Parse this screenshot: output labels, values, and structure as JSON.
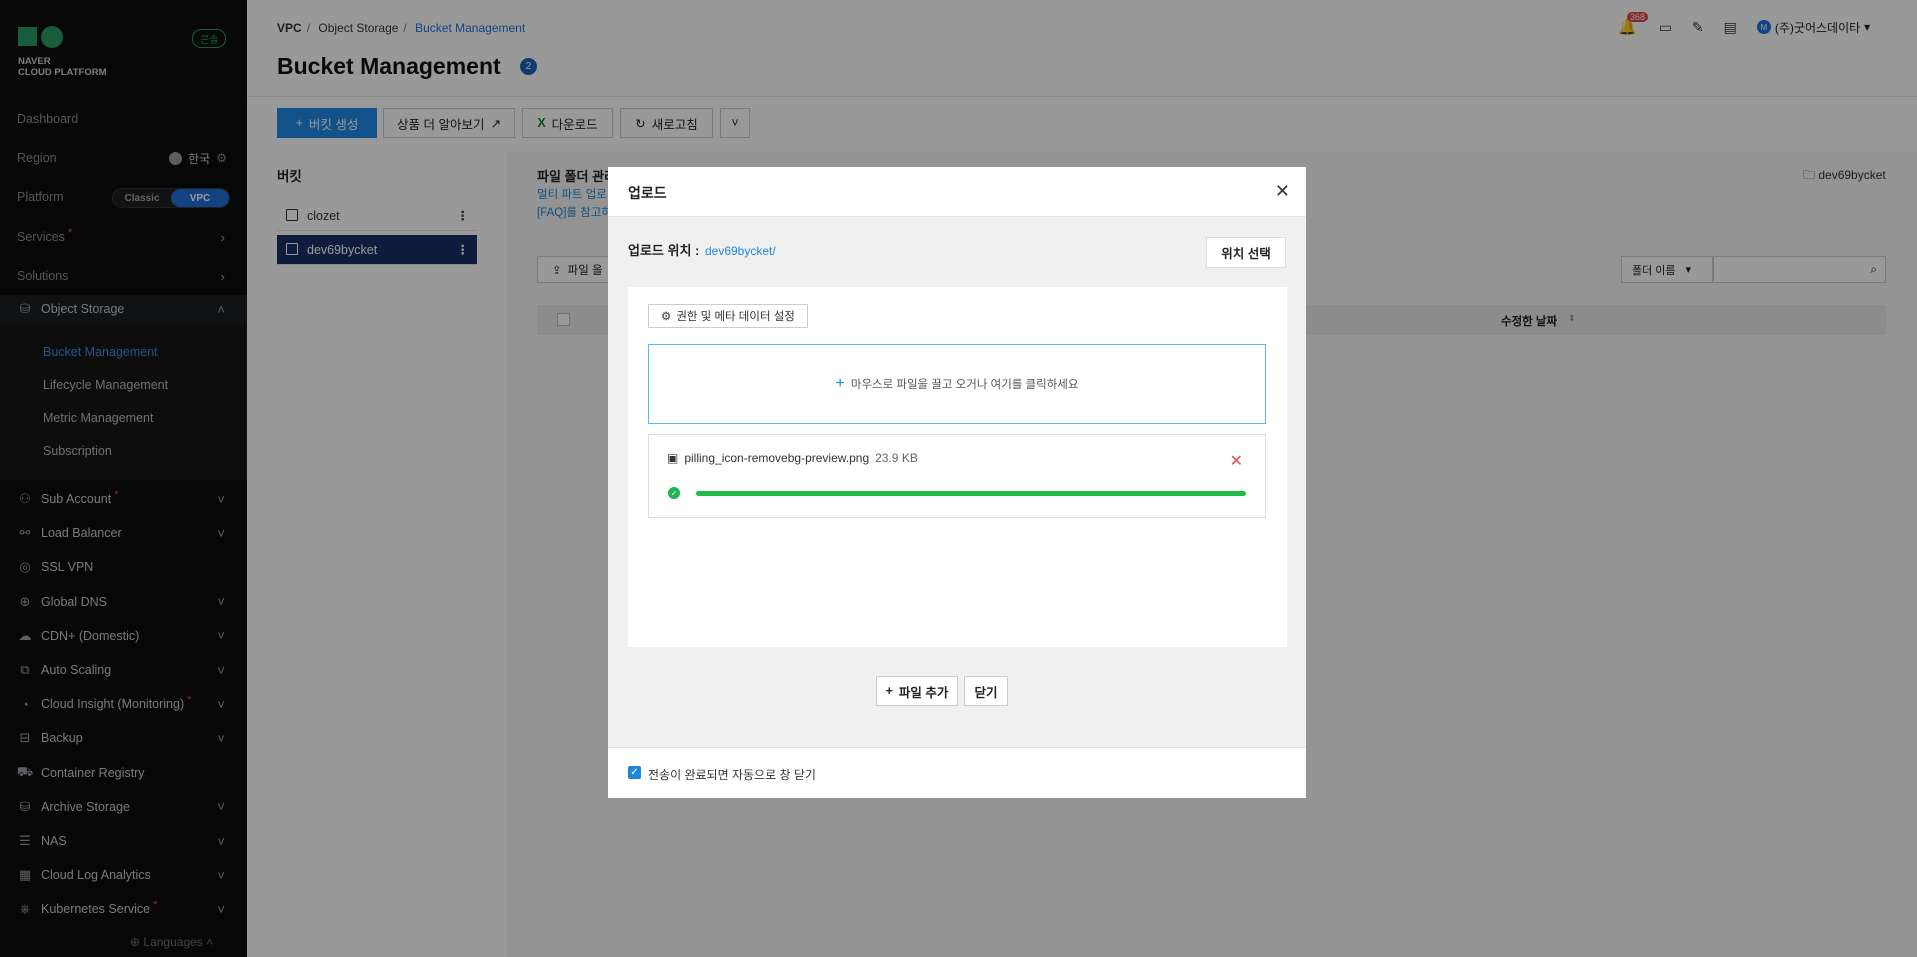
{
  "sidebar": {
    "badge": "콘솔",
    "logo_line1": "NAVER",
    "logo_line2": "CLOUD PLATFORM",
    "dashboard": "Dashboard",
    "region_label": "Region",
    "region_value": "한국",
    "platform_label": "Platform",
    "platform_options": [
      "Classic",
      "VPC"
    ],
    "services": "Services",
    "solutions": "Solutions",
    "object_storage": "Object Storage",
    "os_sub": [
      "Bucket Management",
      "Lifecycle Management",
      "Metric Management",
      "Subscription"
    ],
    "items": [
      {
        "label": "Sub Account",
        "star": true,
        "chevron": true
      },
      {
        "label": "Load Balancer",
        "star": false,
        "chevron": true
      },
      {
        "label": "SSL VPN",
        "star": false,
        "chevron": false
      },
      {
        "label": "Global DNS",
        "star": false,
        "chevron": true
      },
      {
        "label": "CDN+ (Domestic)",
        "star": false,
        "chevron": true
      },
      {
        "label": "Auto Scaling",
        "star": false,
        "chevron": true
      },
      {
        "label": "Cloud Insight (Monitoring)",
        "star": true,
        "chevron": true
      },
      {
        "label": "Backup",
        "star": false,
        "chevron": true
      },
      {
        "label": "Container Registry",
        "star": false,
        "chevron": false
      },
      {
        "label": "Archive Storage",
        "star": false,
        "chevron": true
      },
      {
        "label": "NAS",
        "star": false,
        "chevron": true
      },
      {
        "label": "Cloud Log Analytics",
        "star": false,
        "chevron": true
      },
      {
        "label": "Kubernetes Service",
        "star": true,
        "chevron": true
      }
    ],
    "languages": "Languages"
  },
  "header": {
    "crumbs": [
      "VPC",
      "Object Storage",
      "Bucket Management"
    ],
    "title": "Bucket Management",
    "title_badge": "2",
    "notif_count": "368",
    "user": "(주)굿어스데이타",
    "user_initial": "M"
  },
  "toolbar": {
    "create": "버킷 생성",
    "learn": "상품 더 알아보기",
    "download": "다운로드",
    "refresh": "새로고침"
  },
  "buckets": {
    "title": "버킷",
    "items": [
      "clozet",
      "dev69bycket"
    ]
  },
  "content": {
    "heading": "파일 폴더 관리",
    "desc1": "멀티 파트 업로",
    "desc2": "[FAQ]를 참고하",
    "folder_path": "dev69bycket",
    "upload_btn": "파일 올",
    "folder_select": "폴더 이름",
    "col_modified": "수정한 날짜"
  },
  "modal": {
    "title": "업로드",
    "location_label": "업로드 위치 :",
    "location_value": "dev69bycket/",
    "location_button": "위치 선택",
    "perm_button": "권한 및 메타 데이터 설정",
    "drop_text": "마우스로 파일을 끌고 오거나 여기를 클릭하세요",
    "file": {
      "name": "pilling_icon-removebg-preview.png",
      "size": "23.9 KB",
      "progress": 1.0
    },
    "add_file": "파일 추가",
    "close": "닫기",
    "auto_close": "전송이 완료되면 자동으로 창 닫기"
  }
}
